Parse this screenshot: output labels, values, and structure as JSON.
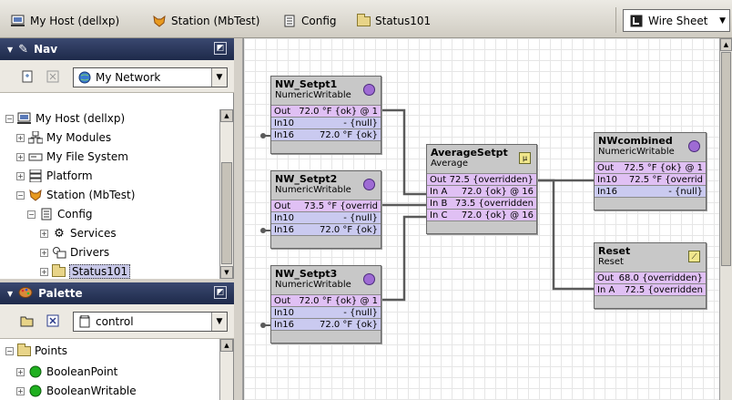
{
  "topbar": {
    "crumbs": [
      {
        "label": "My Host (dellxp)",
        "icon": "host-icon"
      },
      {
        "label": "Station (MbTest)",
        "icon": "station-icon"
      },
      {
        "label": "Config",
        "icon": "config-icon"
      },
      {
        "label": "Status101",
        "icon": "folder-icon"
      }
    ],
    "view_selector": "Wire Sheet"
  },
  "nav": {
    "title": "Nav",
    "root_selector": "My Network",
    "tree": [
      {
        "label": "My Host (dellxp)",
        "expander": "−",
        "icon": "host-icon"
      },
      {
        "label": "My Modules",
        "expander": "+",
        "icon": "modules-icon"
      },
      {
        "label": "My File System",
        "expander": "+",
        "icon": "drive-icon"
      },
      {
        "label": "Platform",
        "expander": "+",
        "icon": "platform-icon"
      },
      {
        "label": "Station (MbTest)",
        "expander": "−",
        "icon": "station-icon"
      },
      {
        "label": "Config",
        "expander": "−",
        "icon": "config-icon"
      },
      {
        "label": "Services",
        "expander": "+",
        "icon": "services-icon"
      },
      {
        "label": "Drivers",
        "expander": "+",
        "icon": "drivers-icon"
      },
      {
        "label": "Status101",
        "expander": "+",
        "icon": "folder-icon"
      }
    ]
  },
  "palette": {
    "title": "Palette",
    "module_selector": "control",
    "tree": [
      {
        "label": "Points",
        "expander": "−",
        "icon": "folder-icon"
      },
      {
        "label": "BooleanPoint",
        "expander": "+",
        "icon": "green-dot-icon"
      },
      {
        "label": "BooleanWritable",
        "expander": "+",
        "icon": "green-dot-icon"
      }
    ]
  },
  "wiresheet": {
    "nw_setpt1": {
      "name": "NW_Setpt1",
      "type": "NumericWritable",
      "slots": [
        {
          "n": "Out",
          "v": "72.0 °F {ok} @ 1"
        },
        {
          "n": "In10",
          "v": "- {null}"
        },
        {
          "n": "In16",
          "v": "72.0 °F {ok}"
        }
      ]
    },
    "nw_setpt2": {
      "name": "NW_Setpt2",
      "type": "NumericWritable",
      "slots": [
        {
          "n": "Out",
          "v": "73.5 °F {overrid"
        },
        {
          "n": "In10",
          "v": "- {null}"
        },
        {
          "n": "In16",
          "v": "72.0 °F {ok}"
        }
      ]
    },
    "nw_setpt3": {
      "name": "NW_Setpt3",
      "type": "NumericWritable",
      "slots": [
        {
          "n": "Out",
          "v": "72.0 °F {ok} @ 1"
        },
        {
          "n": "In10",
          "v": "- {null}"
        },
        {
          "n": "In16",
          "v": "72.0 °F {ok}"
        }
      ]
    },
    "average": {
      "name": "AverageSetpt",
      "type": "Average",
      "slots": [
        {
          "n": "Out",
          "v": "72.5 {overridden}"
        },
        {
          "n": "In A",
          "v": "72.0 {ok} @ 16"
        },
        {
          "n": "In B",
          "v": "73.5 {overridden"
        },
        {
          "n": "In C",
          "v": "72.0 {ok} @ 16"
        }
      ]
    },
    "nwcombined": {
      "name": "NWcombined",
      "type": "NumericWritable",
      "slots": [
        {
          "n": "Out",
          "v": "72.5 °F {ok} @ 1"
        },
        {
          "n": "In10",
          "v": "72.5 °F {overrid"
        },
        {
          "n": "In16",
          "v": "- {null}"
        }
      ]
    },
    "reset": {
      "name": "Reset",
      "type": "Reset",
      "slots": [
        {
          "n": "Out",
          "v": "68.0 {overridden}"
        },
        {
          "n": "In A",
          "v": "72.5 {overridden"
        }
      ]
    }
  },
  "colors": {
    "link": "#5a5a5a",
    "out_slot": "#e0c0f4",
    "in_slot": "#cacaf0",
    "panel_header": "#2a3658"
  }
}
